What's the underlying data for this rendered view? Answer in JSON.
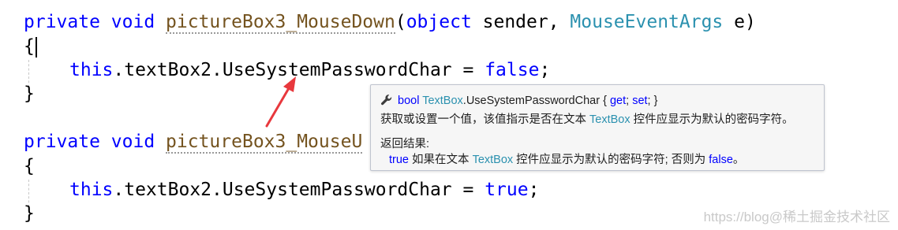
{
  "code": {
    "method1": {
      "keyword_private": "private",
      "keyword_void": "void",
      "name": "pictureBox3_MouseDown",
      "open_paren": "(",
      "keyword_object": "object",
      "param1_name": " sender, ",
      "param2_type": "MouseEventArgs",
      "param2_name": " e)",
      "open_brace": "{",
      "stmt_this": "this",
      "stmt_member": ".textBox2.UseSystemPasswordChar = ",
      "stmt_value": "false",
      "stmt_end": ";",
      "close_brace": "}"
    },
    "method2": {
      "keyword_private": "private",
      "keyword_void": "void",
      "name_visible": "pictureBox3_MouseU",
      "open_brace": "{",
      "stmt_this": "this",
      "stmt_member": ".textBox2.UseSystemPasswordChar = ",
      "stmt_value": "true",
      "stmt_end": ";",
      "close_brace": "}"
    }
  },
  "tooltip": {
    "icon": "wrench-icon",
    "sig_type": "bool",
    "sig_class": "TextBox",
    "sig_member": ".UseSystemPasswordChar { ",
    "sig_get": "get",
    "sig_sep": "; ",
    "sig_set": "set",
    "sig_end": "; }",
    "desc_prefix": "获取或设置一个值，该值指示是否在文本 ",
    "desc_class": "TextBox",
    "desc_suffix": " 控件应显示为默认的密码字符。",
    "returns_label": "返回结果:",
    "ret_true": "true",
    "ret_mid": " 如果在文本 ",
    "ret_class": "TextBox",
    "ret_mid2": " 控件应显示为默认的密码字符; 否则为 ",
    "ret_false": "false",
    "ret_end": "。"
  },
  "watermark": "https://blog@稀土掘金技术社区",
  "colors": {
    "keyword": "#0000ff",
    "type": "#2b91af",
    "method": "#74531f",
    "annotation_arrow": "#e8383d"
  }
}
